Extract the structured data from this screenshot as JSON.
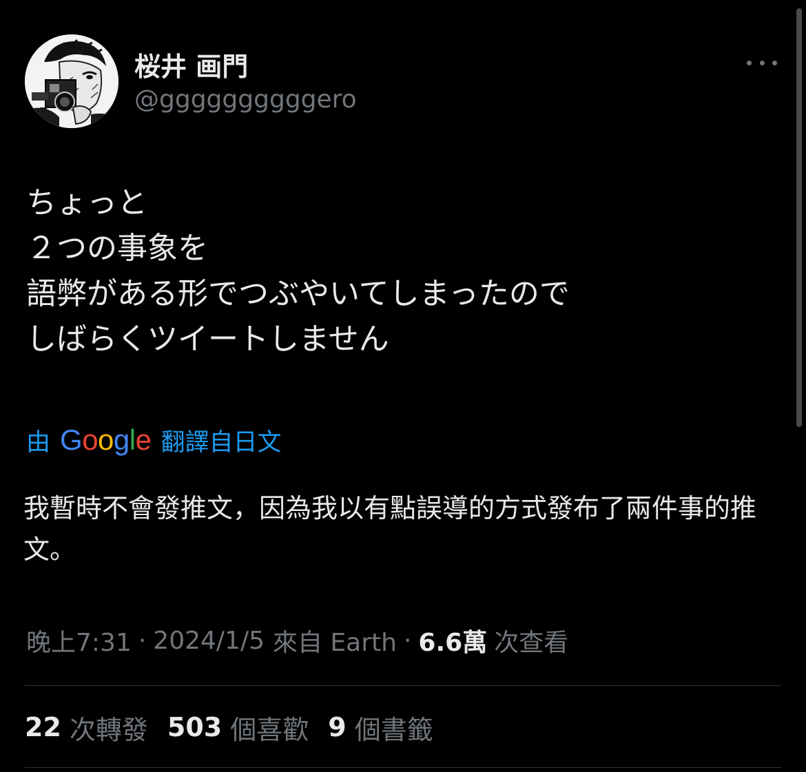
{
  "author": {
    "display_name": "桜井 画門",
    "handle": "@ggggggggggero",
    "avatar_icon": "manga-portrait-avatar"
  },
  "menu_icon": "more-horizontal-icon",
  "tweet": {
    "text": "ちょっと\n２つの事象を\n語弊がある形でつぶやいてしまったので\nしばらくツイートしません"
  },
  "translation": {
    "prefix": "由",
    "provider_logo": [
      "G",
      "o",
      "o",
      "g",
      "l",
      "e"
    ],
    "suffix": "翻譯自日文",
    "text": "我暫時不會發推文，因為我以有點誤導的方式發布了兩件事的推文。"
  },
  "meta": {
    "time": "晚上7:31",
    "date": "2024/1/5",
    "source": "來自 Earth",
    "views_count": "6.6萬",
    "views_label": "次查看",
    "separator": "·"
  },
  "stats": {
    "retweets_count": "22",
    "retweets_label": "次轉發",
    "likes_count": "503",
    "likes_label": "個喜歡",
    "bookmarks_count": "9",
    "bookmarks_label": "個書籤"
  },
  "colors": {
    "background": "#000000",
    "text_primary": "#e7e9ea",
    "text_secondary": "#71767b",
    "link": "#1d9bf0",
    "divider": "#2f3336",
    "google_blue": "#4285f4",
    "google_red": "#ea4335",
    "google_yellow": "#fbbc05",
    "google_green": "#34a853"
  }
}
